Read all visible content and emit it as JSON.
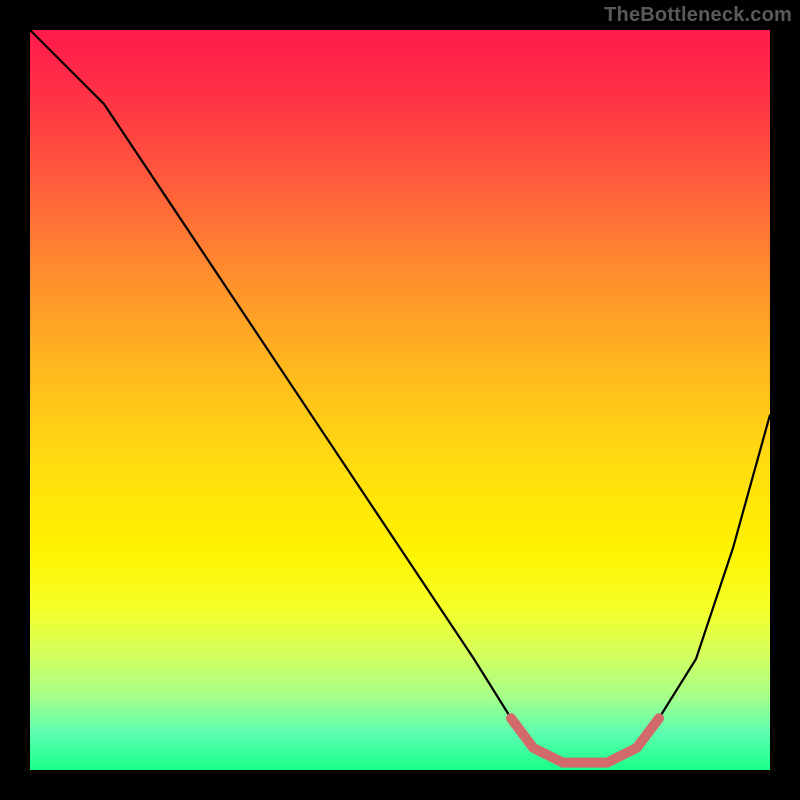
{
  "watermark": "TheBottleneck.com",
  "chart_data": {
    "type": "line",
    "title": "",
    "xlabel": "",
    "ylabel": "",
    "xlim": [
      0,
      100
    ],
    "ylim": [
      0,
      100
    ],
    "series": [
      {
        "name": "curve",
        "x": [
          0,
          5,
          10,
          20,
          30,
          40,
          50,
          60,
          65,
          68,
          72,
          78,
          82,
          85,
          90,
          95,
          100
        ],
        "values": [
          100,
          95,
          90,
          75,
          60,
          45,
          30,
          15,
          7,
          3,
          1,
          1,
          3,
          7,
          15,
          30,
          48
        ]
      },
      {
        "name": "highlight",
        "x": [
          65,
          68,
          72,
          78,
          82,
          85
        ],
        "values": [
          7,
          3,
          1,
          1,
          3,
          7
        ]
      }
    ],
    "annotations": [],
    "background_gradient_stops": [
      {
        "pos": 0.0,
        "color": "#ff1a4b"
      },
      {
        "pos": 0.08,
        "color": "#ff2f46"
      },
      {
        "pos": 0.2,
        "color": "#ff5a3c"
      },
      {
        "pos": 0.32,
        "color": "#ff8a2e"
      },
      {
        "pos": 0.45,
        "color": "#ffb61f"
      },
      {
        "pos": 0.58,
        "color": "#ffdb10"
      },
      {
        "pos": 0.7,
        "color": "#fff300"
      },
      {
        "pos": 0.78,
        "color": "#f6ff27"
      },
      {
        "pos": 0.84,
        "color": "#d6ff5a"
      },
      {
        "pos": 0.9,
        "color": "#a8ff8a"
      },
      {
        "pos": 0.95,
        "color": "#5cffb0"
      },
      {
        "pos": 1.0,
        "color": "#19ff88"
      }
    ]
  }
}
